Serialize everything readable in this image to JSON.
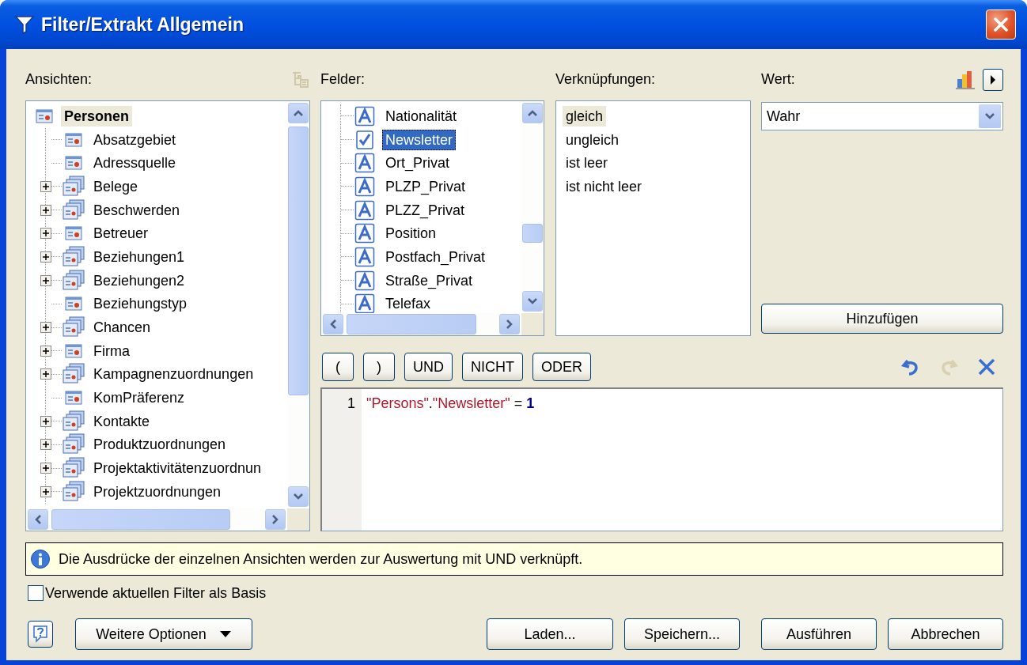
{
  "window": {
    "title": "Filter/Extrakt Allgemein"
  },
  "ansichten": {
    "label": "Ansichten:",
    "tree": [
      {
        "label": "Personen",
        "kind": "table",
        "selected": true,
        "children": [
          {
            "label": "Absatzgebiet",
            "kind": "table",
            "selected": false,
            "expandable": false
          },
          {
            "label": "Adressquelle",
            "kind": "table",
            "selected": false,
            "expandable": false
          },
          {
            "label": "Belege",
            "kind": "group",
            "selected": false,
            "expandable": true
          },
          {
            "label": "Beschwerden",
            "kind": "group",
            "selected": false,
            "expandable": true
          },
          {
            "label": "Betreuer",
            "kind": "table",
            "selected": false,
            "expandable": true
          },
          {
            "label": "Beziehungen1",
            "kind": "group",
            "selected": false,
            "expandable": true
          },
          {
            "label": "Beziehungen2",
            "kind": "group",
            "selected": false,
            "expandable": true
          },
          {
            "label": "Beziehungstyp",
            "kind": "table",
            "selected": false,
            "expandable": false
          },
          {
            "label": "Chancen",
            "kind": "group",
            "selected": false,
            "expandable": true
          },
          {
            "label": "Firma",
            "kind": "table",
            "selected": false,
            "expandable": true
          },
          {
            "label": "Kampagnenzuordnungen",
            "kind": "group",
            "selected": false,
            "expandable": true
          },
          {
            "label": "KomPräferenz",
            "kind": "table",
            "selected": false,
            "expandable": false
          },
          {
            "label": "Kontakte",
            "kind": "group",
            "selected": false,
            "expandable": true
          },
          {
            "label": "Produktzuordnungen",
            "kind": "group",
            "selected": false,
            "expandable": true
          },
          {
            "label": "Projektaktivitätenzuordnun",
            "kind": "group",
            "selected": false,
            "expandable": true
          },
          {
            "label": "Projektzuordnungen",
            "kind": "group",
            "selected": false,
            "expandable": true
          }
        ]
      }
    ]
  },
  "felder": {
    "label": "Felder:",
    "items": [
      {
        "label": "Nationalität",
        "kind": "text",
        "selected": false
      },
      {
        "label": "Newsletter",
        "kind": "boolean",
        "selected": true
      },
      {
        "label": "Ort_Privat",
        "kind": "text",
        "selected": false
      },
      {
        "label": "PLZP_Privat",
        "kind": "text",
        "selected": false
      },
      {
        "label": "PLZZ_Privat",
        "kind": "text",
        "selected": false
      },
      {
        "label": "Position",
        "kind": "text",
        "selected": false
      },
      {
        "label": "Postfach_Privat",
        "kind": "text",
        "selected": false
      },
      {
        "label": "Straße_Privat",
        "kind": "text",
        "selected": false
      },
      {
        "label": "Telefax",
        "kind": "text",
        "selected": false
      }
    ]
  },
  "verknuepfungen": {
    "label": "Verknüpfungen:",
    "items": [
      {
        "label": "gleich",
        "selected": true
      },
      {
        "label": "ungleich",
        "selected": false
      },
      {
        "label": "ist leer",
        "selected": false
      },
      {
        "label": "ist nicht leer",
        "selected": false
      }
    ]
  },
  "wert": {
    "label": "Wert:",
    "value": "Wahr"
  },
  "add_button": "Hinzufügen",
  "operators": [
    "(",
    ")",
    "UND",
    "NICHT",
    "ODER"
  ],
  "editor": {
    "lines": [
      {
        "number": "1",
        "tokens": [
          {
            "text": "\"Persons\"",
            "kind": "string"
          },
          {
            "text": ".",
            "kind": "plain"
          },
          {
            "text": "\"Newsletter\"",
            "kind": "string"
          },
          {
            "text": " = ",
            "kind": "plain"
          },
          {
            "text": "1",
            "kind": "number"
          }
        ]
      }
    ]
  },
  "info": "Die Ausdrücke der einzelnen Ansichten werden zur Auswertung mit UND verknüpft.",
  "base_filter": {
    "label": "Verwende aktuellen Filter als Basis",
    "checked": false
  },
  "more_options": "Weitere Optionen",
  "buttons": [
    "Laden...",
    "Speichern...",
    "Ausführen",
    "Abbrechen"
  ]
}
